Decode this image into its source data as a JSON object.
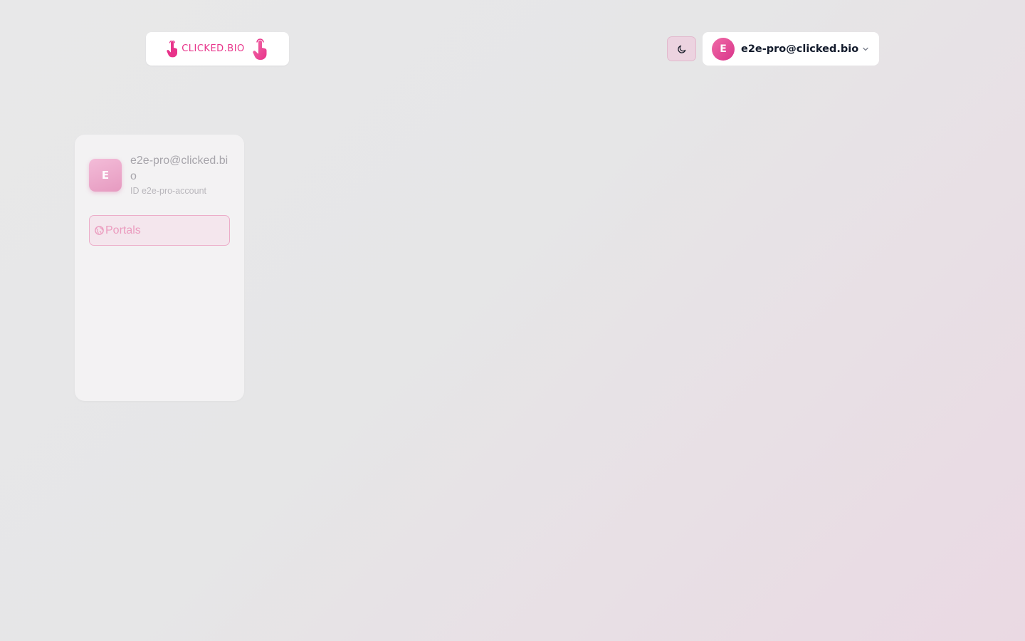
{
  "header": {
    "logo_text": "CLICKED.BIO",
    "theme_toggle_icon": "moon-icon",
    "user": {
      "avatar_initial": "E",
      "email": "e2e-pro@clicked.bio",
      "menu_icon": "chevron-down-icon"
    }
  },
  "account_card": {
    "avatar_initial": "E",
    "name": "e2e-pro@clicked.bio",
    "id_text": "ID e2e-pro-account",
    "nav": [
      {
        "label": "Portals",
        "icon": "globe-icon"
      }
    ]
  },
  "colors": {
    "brand_pink": "#e8338a",
    "text_dark": "#121a2b"
  }
}
